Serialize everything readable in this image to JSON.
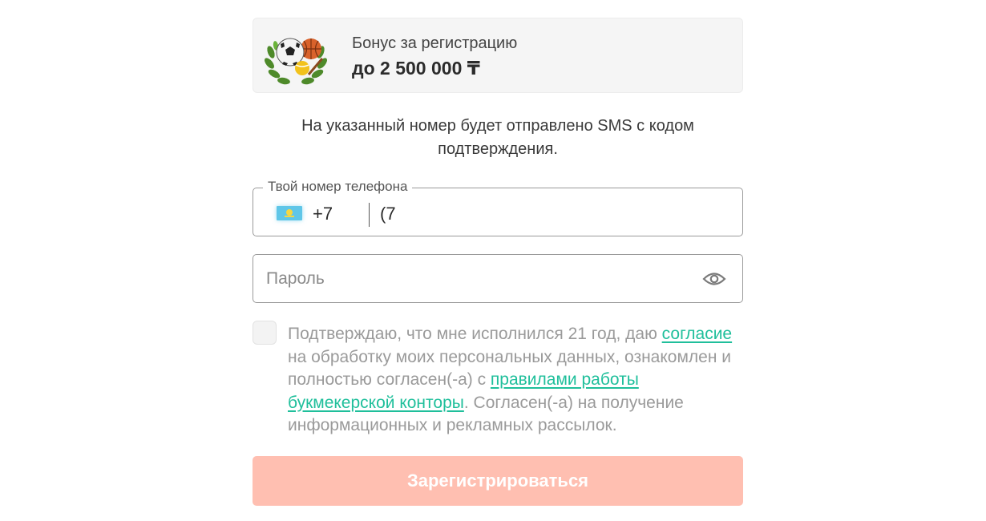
{
  "bonus": {
    "title": "Бонус за регистрацию",
    "amount": "до 2 500 000 ₸",
    "image_icon": "sports-balls-laurel-icon"
  },
  "sms_info": "На указанный номер будет отправлено SMS с кодом подтверждения.",
  "phone": {
    "label": "Твой номер телефона",
    "flag_icon": "kazakhstan-flag-icon",
    "country_code": "+7",
    "value": "(7"
  },
  "password": {
    "placeholder": "Пароль",
    "toggle_icon": "eye-icon"
  },
  "consent": {
    "checked": false,
    "text_1": "Подтверждаю, что мне исполнился 21 год, даю ",
    "link_consent": "согласие",
    "text_2": " на обработку моих персональных данных, ознакомлен и полностью согласен(-а) с ",
    "link_rules": "правилами работы букмекерской конторы",
    "text_3": ". Согласен(-а) на получение информационных и рекламных рассылок."
  },
  "register_button": "Зарегистрироваться",
  "colors": {
    "accent_link": "#1fbf9b",
    "button_disabled": "#ffbfb1",
    "card_background": "#f5f5f5"
  }
}
